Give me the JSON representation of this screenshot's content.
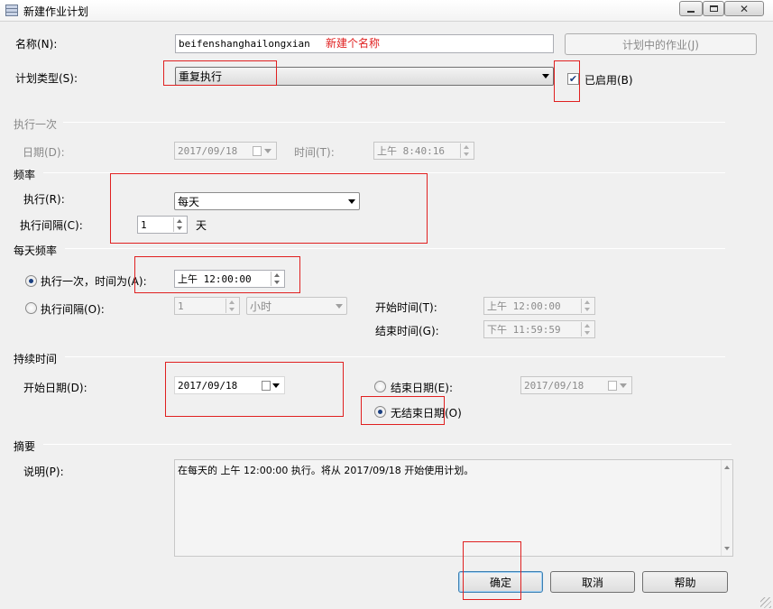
{
  "window": {
    "title": "新建作业计划",
    "controls": [
      "minimize-icon",
      "maximize-icon",
      "close-icon"
    ]
  },
  "name": {
    "label": "名称(N):",
    "value": "beifenshanghailongxian",
    "annotation": "新建个名称",
    "annotation_color": "#e02020"
  },
  "jobs_in_schedule_button": "计划中的作业(J)",
  "schedule_type": {
    "label": "计划类型(S):",
    "value": "重复执行",
    "enabled_label": "已启用(B)",
    "enabled_checked": true
  },
  "one_time": {
    "section": "执行一次",
    "date_label": "日期(D):",
    "date_value": "2017/09/18",
    "time_label": "时间(T):",
    "time_value": "上午  8:40:16"
  },
  "frequency": {
    "section": "频率",
    "occurs_label": "执行(R):",
    "occurs_value": "每天",
    "recurs_label": "执行间隔(C):",
    "recurs_value": "1",
    "recurs_unit": "天"
  },
  "daily_frequency": {
    "section": "每天频率",
    "once_label": "执行一次，时间为(A):",
    "once_selected": true,
    "once_value": "上午 12:00:00",
    "every_label": "执行间隔(O):",
    "every_value": "1",
    "every_unit": "小时",
    "start_label": "开始时间(T):",
    "start_value": "上午 12:00:00",
    "end_label": "结束时间(G):",
    "end_value": "下午 11:59:59"
  },
  "duration": {
    "section": "持续时间",
    "start_label": "开始日期(D):",
    "start_value": "2017/09/18",
    "end_date_label": "结束日期(E):",
    "end_date_value": "2017/09/18",
    "no_end_label": "无结束日期(O)",
    "no_end_selected": true
  },
  "summary": {
    "section": "摘要",
    "description_label": "说明(P):",
    "description": "在每天的 上午 12:00:00 执行。将从 2017/09/18 开始使用计划。"
  },
  "buttons": {
    "ok": "确定",
    "cancel": "取消",
    "help": "帮助"
  }
}
